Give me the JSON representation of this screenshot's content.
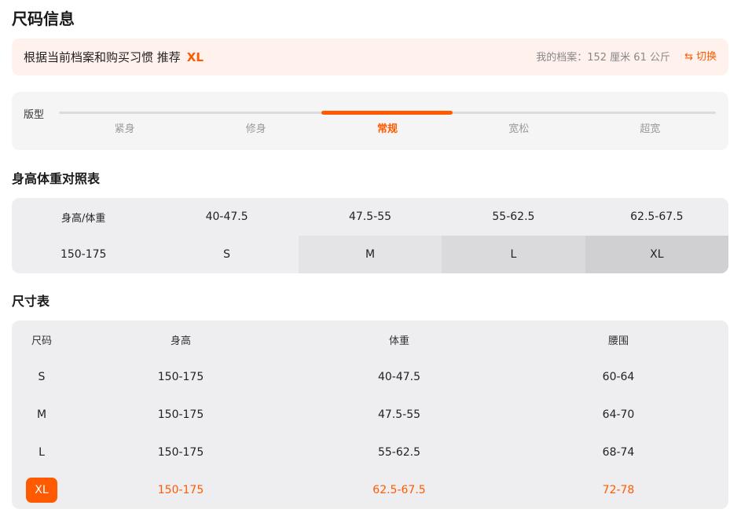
{
  "page_title": "尺码信息",
  "recommendation": {
    "text": "根据当前档案和购买习惯 推荐",
    "size": "XL",
    "profile": "我的档案：152 厘米 61 公斤",
    "switch_label": "切换",
    "switch_icon": "swap-arrows-icon"
  },
  "fit": {
    "label": "版型",
    "options": [
      "紧身",
      "修身",
      "常规",
      "宽松",
      "超宽"
    ],
    "selected": "常规"
  },
  "hw_table": {
    "title": "身高体重对照表",
    "header": [
      "身高/体重",
      "40-47.5",
      "47.5-55",
      "55-62.5",
      "62.5-67.5"
    ],
    "row": [
      "150-175",
      "S",
      "M",
      "L",
      "XL"
    ]
  },
  "size_table": {
    "title": "尺寸表",
    "columns": [
      "尺码",
      "身高",
      "体重",
      "腰围"
    ],
    "rows": [
      [
        "S",
        "150-175",
        "40-47.5",
        "60-64"
      ],
      [
        "M",
        "150-175",
        "47.5-55",
        "64-70"
      ],
      [
        "L",
        "150-175",
        "55-62.5",
        "68-74"
      ],
      [
        "XL",
        "150-175",
        "62.5-67.5",
        "72-78"
      ]
    ],
    "selected_size": "XL"
  },
  "colors": {
    "accent": "#ff5a00",
    "reco_bg": "#fff1ec",
    "card_bg": "#eeeef0"
  }
}
